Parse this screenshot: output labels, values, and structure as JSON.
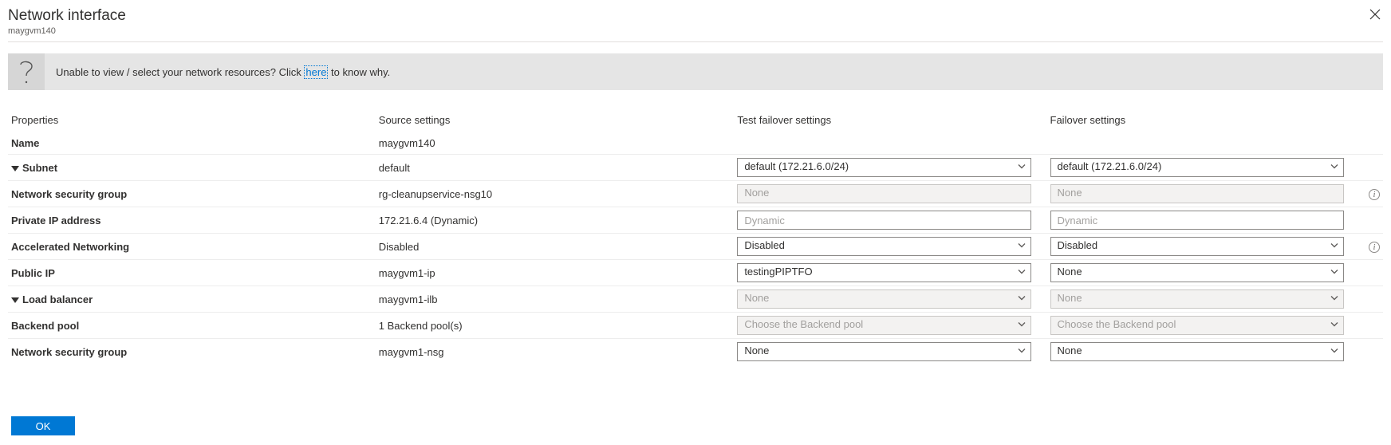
{
  "header": {
    "title": "Network interface",
    "subtitle": "maygvm140"
  },
  "infoBar": {
    "prefix": "Unable to view / select your network resources? Click ",
    "link": "here",
    "suffix": " to know why."
  },
  "columns": {
    "properties": "Properties",
    "source": "Source settings",
    "test": "Test failover settings",
    "failover": "Failover settings"
  },
  "rows": {
    "name": {
      "label": "Name",
      "source": "maygvm140"
    },
    "subnet": {
      "label": "Subnet",
      "source": "default",
      "test": "default (172.21.6.0/24)",
      "failover": "default (172.21.6.0/24)"
    },
    "nsg_child": {
      "label": "Network security group",
      "source": "rg-cleanupservice-nsg10",
      "test": "None",
      "failover": "None"
    },
    "private_ip": {
      "label": "Private IP address",
      "source": "172.21.6.4 (Dynamic)",
      "test_placeholder": "Dynamic",
      "failover_placeholder": "Dynamic"
    },
    "accel": {
      "label": "Accelerated Networking",
      "source": "Disabled",
      "test": "Disabled",
      "failover": "Disabled"
    },
    "public_ip": {
      "label": "Public IP",
      "source": "maygvm1-ip",
      "test": "testingPIPTFO",
      "failover": "None"
    },
    "lb": {
      "label": "Load balancer",
      "source": "maygvm1-ilb",
      "test": "None",
      "failover": "None"
    },
    "backend": {
      "label": "Backend pool",
      "source": "1 Backend pool(s)",
      "test": "Choose the Backend pool",
      "failover": "Choose the Backend pool"
    },
    "nsg": {
      "label": "Network security group",
      "source": "maygvm1-nsg",
      "test": "None",
      "failover": "None"
    }
  },
  "buttons": {
    "ok": "OK"
  }
}
